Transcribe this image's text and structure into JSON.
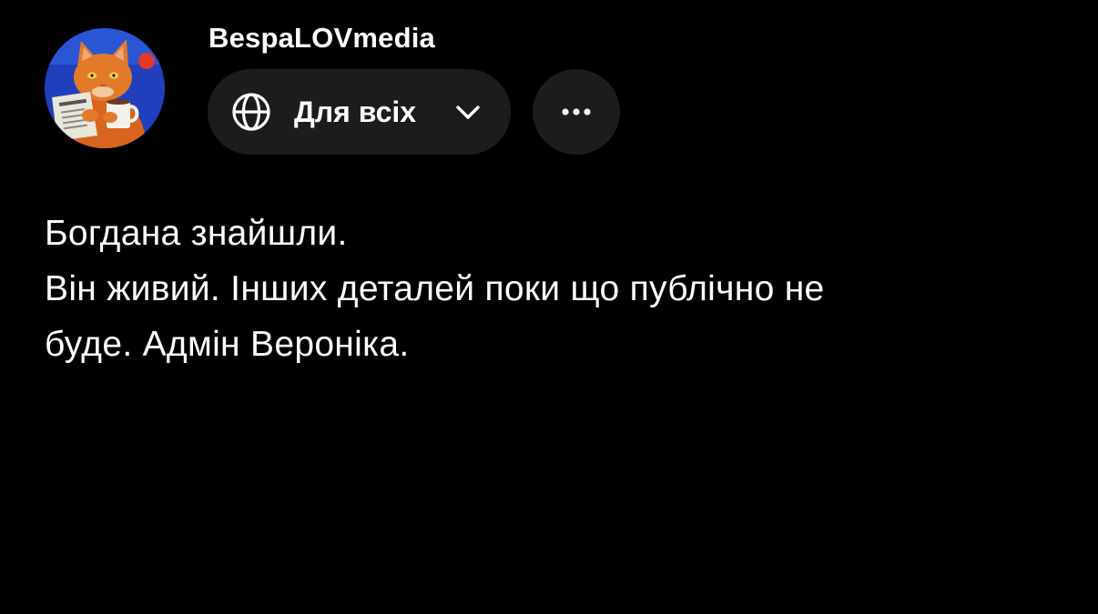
{
  "post": {
    "author": "BespaLOVmedia",
    "audience_label": "Для всіх",
    "avatar_icon": "cat-reading-newspaper-avatar",
    "lines": [
      "Богдана знайшли.",
      "Він живий. Інших деталей поки що публічно не",
      "буде. Адмін Вероніка."
    ]
  },
  "colors": {
    "background": "#000000",
    "pill_background": "#1c1c1e",
    "text": "#ffffff"
  }
}
